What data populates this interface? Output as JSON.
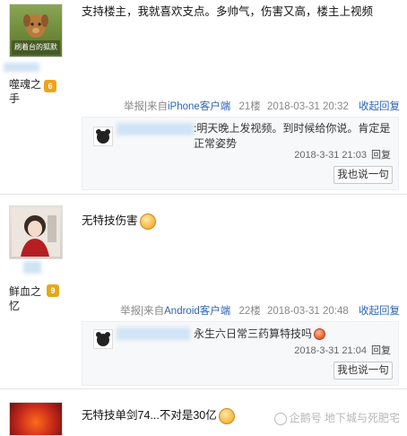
{
  "posts": [
    {
      "username": "噬魂之手",
      "avatar_caption": "刷着台的狐默",
      "badge": "6",
      "badge_color": "#f0a21c",
      "content": "支持楼主，我就喜欢支点。多帅气，伤害又高，楼主上视频",
      "report": "举报",
      "source_prefix": "|来自",
      "source": "iPhone客户端",
      "floor": "21楼",
      "datetime": "2018-03-31 20:32",
      "collapse": "收起回复",
      "reply": {
        "text": ":明天晚上发视频。到时候给你说。肯定是正常姿势",
        "time": "2018-3-31 21:03",
        "reply_label": "回复",
        "say_button": "我也说一句"
      }
    },
    {
      "username": "鲜血之忆",
      "badge": "9",
      "badge_color": "#e5a818",
      "content": "无特技伤害",
      "report": "举报",
      "source_prefix": "|来自",
      "source": "Android客户端",
      "floor": "22楼",
      "datetime": "2018-03-31 20:48",
      "collapse": "收起回复",
      "reply": {
        "text": "永生六日常三药算特技吗",
        "time": "2018-3-31 21:04",
        "reply_label": "回复",
        "say_button": "我也说一句"
      }
    },
    {
      "content": "无特技单剑74...不对是30亿"
    }
  ],
  "watermark": "企鹅号 地下城与死肥宅"
}
